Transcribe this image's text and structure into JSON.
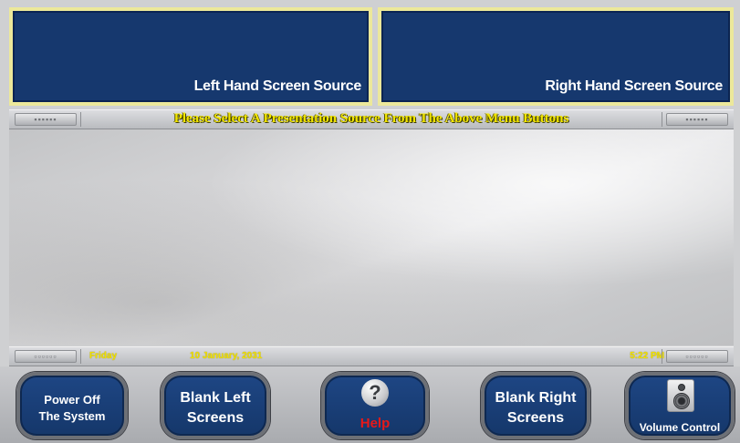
{
  "top_sources": {
    "left_label": "Left Hand Screen Source",
    "right_label": "Right Hand Screen Source"
  },
  "top_bar": {
    "prompt": "Please Select A Presentation Source From The Above Menu Buttons",
    "grip_left": "▪▪▪▪▪▪",
    "grip_right": "▪▪▪▪▪▪"
  },
  "status_bar": {
    "day": "Friday",
    "date": "10 January, 2031",
    "time": "5:22 PM",
    "grip_left": "▫▫▫▫▫▫",
    "grip_right": "▫▫▫▫▫▫"
  },
  "controls": {
    "power_line1": "Power Off",
    "power_line2": "The System",
    "blank_left_line1": "Blank Left",
    "blank_left_line2": "Screens",
    "help_icon": "?",
    "help_label": "Help",
    "blank_right_line1": "Blank Right",
    "blank_right_line2": "Screens",
    "volume_label": "Volume Control"
  },
  "icons": {
    "help": "question-mark-icon",
    "volume": "speaker-icon"
  },
  "colors": {
    "button_blue": "#16386e",
    "source_border": "#ece89a",
    "status_yellow": "#f0e000",
    "help_red": "#e81818"
  }
}
